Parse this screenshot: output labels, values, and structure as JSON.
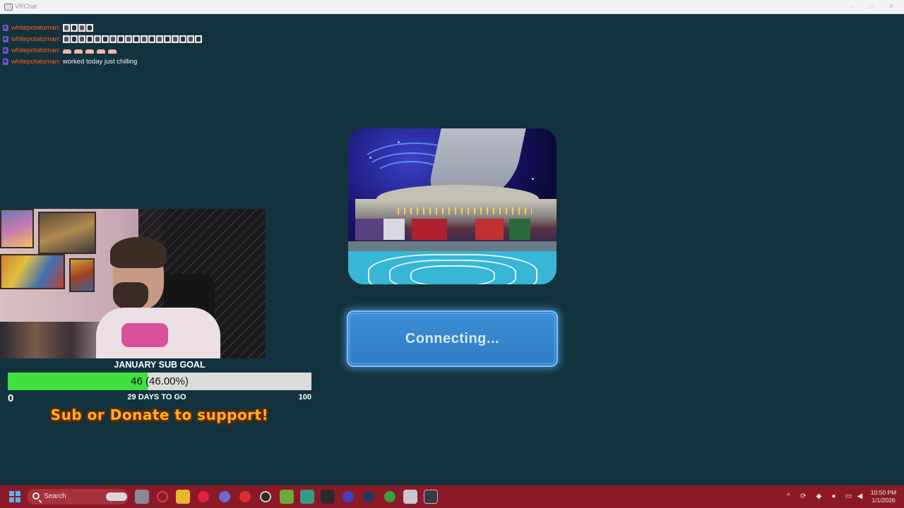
{
  "window": {
    "title": "VRChat"
  },
  "chat": {
    "messages": [
      {
        "user": "whitepotatoman",
        "text": "",
        "emotes": "strip-short"
      },
      {
        "user": "whitepotatoman",
        "text": "",
        "emotes": "strip-long"
      },
      {
        "user": "whitepotatoman",
        "text": "",
        "emotes": "small"
      },
      {
        "user": "whitepotatoman",
        "text": "worked today just chilling",
        "emotes": "none"
      }
    ]
  },
  "sub_goal": {
    "title": "JANUARY SUB GOAL",
    "current": 46,
    "target": 100,
    "progress_fraction": 0.46,
    "bar_text": "46 (46.00%)",
    "min_label": "0",
    "max_label": "100",
    "days_text": "29 DAYS TO GO",
    "support_text": "Sub or Donate to support!"
  },
  "vrchat": {
    "status_label": "Connecting..."
  },
  "colors": {
    "background": "#12333d",
    "chat_username": "#ff5a1f",
    "goal_fill": "#40e040",
    "button": "#3d8fd6",
    "taskbar": "#8b1a26"
  },
  "taskbar": {
    "search_placeholder": "Search",
    "apps": [
      "task-view-icon",
      "recorder-icon",
      "file-explorer-icon",
      "opera-icon",
      "discord-icon",
      "app-icon",
      "obs-icon",
      "nvidia-icon",
      "app-icon",
      "sparkle-icon",
      "app-icon",
      "steam-icon",
      "xbox-icon",
      "app-icon",
      "vrchat-icon"
    ],
    "tray_icons": [
      "chevron-up-icon",
      "sync-icon",
      "network-icon",
      "microphone-icon",
      "display-icon",
      "volume-icon"
    ],
    "time": "10:50 PM",
    "date": "1/1/2026"
  }
}
